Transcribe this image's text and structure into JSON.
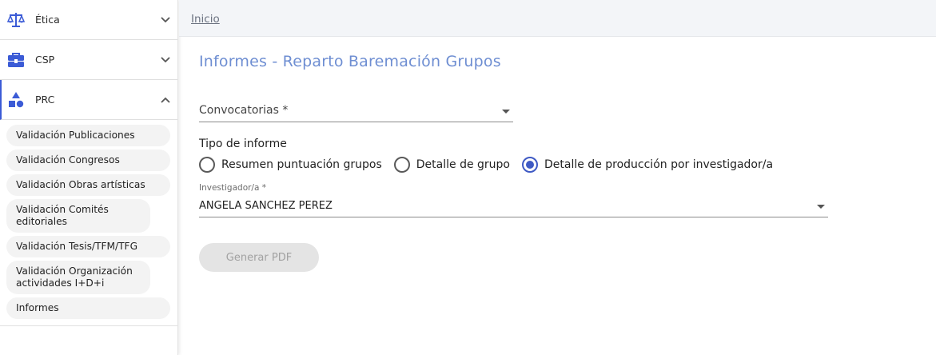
{
  "sidebar": {
    "modules": [
      {
        "label": "Ética",
        "icon": "scale-icon",
        "expanded": false
      },
      {
        "label": "CSP",
        "icon": "briefcase-icon",
        "expanded": false
      },
      {
        "label": "PRC",
        "icon": "shapes-icon",
        "expanded": true
      }
    ],
    "prc_items": [
      "Validación Publicaciones",
      "Validación Congresos",
      "Validación Obras artísticas",
      "Validación Comités editoriales",
      "Validación Tesis/TFM/TFG",
      "Validación Organización actividades I+D+i",
      "Informes"
    ]
  },
  "breadcrumb": {
    "home": "Inicio"
  },
  "page": {
    "title": "Informes - Reparto Baremación Grupos"
  },
  "form": {
    "convocatorias": {
      "placeholder": "Convocatorias *",
      "value": ""
    },
    "tipo_informe": {
      "label": "Tipo de informe",
      "options": [
        {
          "label": "Resumen puntuación grupos",
          "checked": false
        },
        {
          "label": "Detalle de grupo",
          "checked": false
        },
        {
          "label": "Detalle de producción por investigador/a",
          "checked": true
        }
      ]
    },
    "investigador": {
      "label": "Investigador/a *",
      "value": "ANGELA SANCHEZ PEREZ"
    },
    "generate_button": {
      "label": "Generar PDF",
      "disabled": true
    }
  },
  "colors": {
    "accent": "#3f5ac4",
    "title": "#6e8ed2",
    "icon": "#3b5bd6"
  }
}
